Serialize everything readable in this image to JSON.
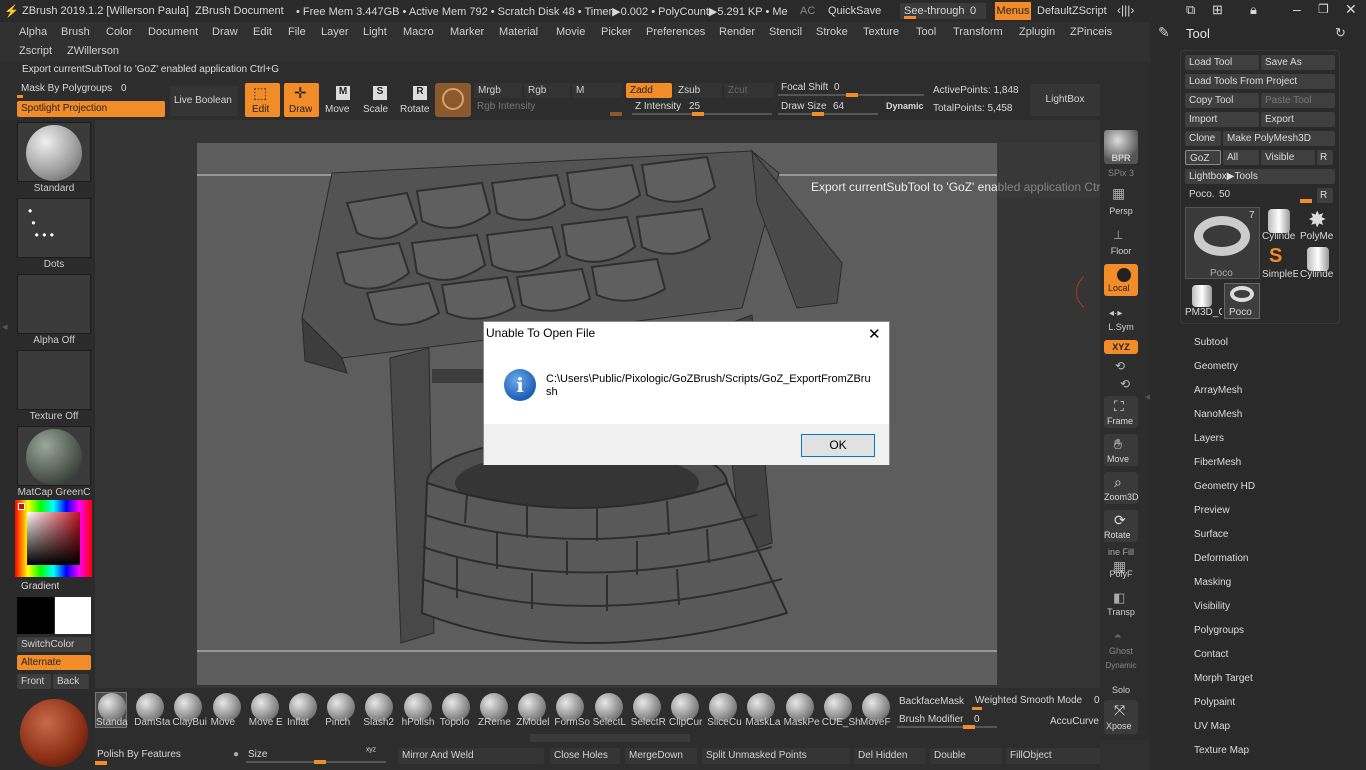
{
  "titlebar": {
    "app_title": "ZBrush 2019.1.2 [Willerson Paula]",
    "doc": "ZBrush Document",
    "stats": "• Free Mem 3.447GB • Active Mem 792 • Scratch Disk 48 • Timer▶0.002 • PolyCount▶5.291 KP • Me",
    "ac": "AC",
    "quicksave": "QuickSave",
    "seethrough": "See-through",
    "seethrough_val": "0",
    "menus": "Menus",
    "zscript": "DefaultZScript"
  },
  "menu": {
    "row1": [
      "Alpha",
      "Brush",
      "Color",
      "Document",
      "Draw",
      "Edit",
      "File",
      "Layer",
      "Light",
      "Macro",
      "Marker",
      "Material",
      "Movie",
      "Picker",
      "Preferences",
      "Render",
      "Stencil",
      "Stroke",
      "Texture",
      "Tool",
      "Transform",
      "Zplugin",
      "ZPinceis"
    ],
    "row2": [
      "Zscript",
      "ZWillerson"
    ]
  },
  "hint": "Export currentSubTool to 'GoZ' enabled application Ctrl+G",
  "topshelf": {
    "mask_by_poly": "Mask By Polygroups",
    "mask_val": "0",
    "spotlight": "Spotlight Projection",
    "live_boolean": "Live Boolean",
    "edit": "Edit",
    "draw": "Draw",
    "move": "Move",
    "scale": "Scale",
    "rotate": "Rotate",
    "mrgb": "Mrgb",
    "rgb": "Rgb",
    "m": "M",
    "zadd": "Zadd",
    "zsub": "Zsub",
    "zcut": "Zcut",
    "rgb_intensity": "Rgb Intensity",
    "z_intensity": "Z Intensity",
    "z_intensity_val": "25",
    "focal_shift": "Focal Shift",
    "focal_shift_val": "0",
    "draw_size": "Draw Size",
    "draw_size_val": "64",
    "dynamic": "Dynamic",
    "active_points": "ActivePoints: 1,848",
    "total_points": "TotalPoints: 5,458",
    "lightbox": "LightBox"
  },
  "leftshelf": {
    "standard": "Standard",
    "dots": "Dots",
    "alpha_off": "Alpha Off",
    "texture_off": "Texture Off",
    "matcap": "MatCap GreenC",
    "gradient": "Gradient",
    "switchcolor": "SwitchColor",
    "alternate": "Alternate",
    "front": "Front",
    "back": "Back"
  },
  "canvas": {
    "tooltip": "Export currentSubTool to 'GoZ' enabled application  Ctrl+G"
  },
  "rightshelf": {
    "bpr": "BPR",
    "spix": "SPix 3",
    "persp": "Persp",
    "floor": "Floor",
    "local": "Local",
    "lsym": "L.Sym",
    "xyz": "XYZ",
    "frame": "Frame",
    "move": "Move",
    "zoom3d": "Zoom3D",
    "rotate": "Rotate",
    "linefill": "ine Fill",
    "polyf": "PolyF",
    "transp": "Transp",
    "ghost": "Ghost",
    "dynamic": "Dynamic",
    "solo": "Solo",
    "xpose": "Xpose"
  },
  "toolpanel": {
    "title": "Tool",
    "load_tool": "Load Tool",
    "save_as": "Save As",
    "load_project": "Load Tools From Project",
    "copy_tool": "Copy Tool",
    "paste_tool": "Paste Tool",
    "import": "Import",
    "export": "Export",
    "clone": "Clone",
    "make_polymesh": "Make PolyMesh3D",
    "goz": "GoZ",
    "all": "All",
    "visible": "Visible",
    "r": "R",
    "lightbox_tools": "Lightbox▶Tools",
    "poco": "Poco.",
    "poco_val": "50",
    "count": "7",
    "tools": [
      "Poco",
      "Cylinde",
      "PolyMe",
      "SimpleE",
      "Cylinde",
      "PM3D_C",
      "Poco"
    ],
    "subpalettes": [
      "Subtool",
      "Geometry",
      "ArrayMesh",
      "NanoMesh",
      "Layers",
      "FiberMesh",
      "Geometry HD",
      "Preview",
      "Surface",
      "Deformation",
      "Masking",
      "Visibility",
      "Polygroups",
      "Contact",
      "Morph Target",
      "Polypaint",
      "UV Map",
      "Texture Map"
    ]
  },
  "bottomshelf": {
    "brushes": [
      "Standa",
      "DamSta",
      "ClayBui",
      "Move",
      "Move E",
      "Inflat",
      "Pinch",
      "Slash2",
      "hPolish",
      "Topolo",
      "ZReme",
      "ZModel",
      "FormSo",
      "SelectL",
      "SelectR",
      "ClipCur",
      "SliceCu",
      "MaskLa",
      "MaskPe",
      "CUE_Sh",
      "MoveF"
    ],
    "backfacemask": "BackfaceMask",
    "weighted": "Weighted Smooth Mode",
    "weighted_val": "0",
    "brush_modifier": "Brush Modifier",
    "brush_modifier_val": "0",
    "accucurve": "AccuCurve",
    "polish": "Polish By Features",
    "size": "Size",
    "mirror_weld": "Mirror And Weld",
    "close_holes": "Close Holes",
    "mergedown": "MergeDown",
    "split_unmasked": "Split Unmasked Points",
    "del_hidden": "Del Hidden",
    "double": "Double",
    "fillobject": "FillObject"
  },
  "dialog": {
    "title": "Unable To Open File",
    "message": "C:\\Users\\Public/Pixologic/GoZBrush/Scripts/GoZ_ExportFromZBrush",
    "ok": "OK"
  }
}
